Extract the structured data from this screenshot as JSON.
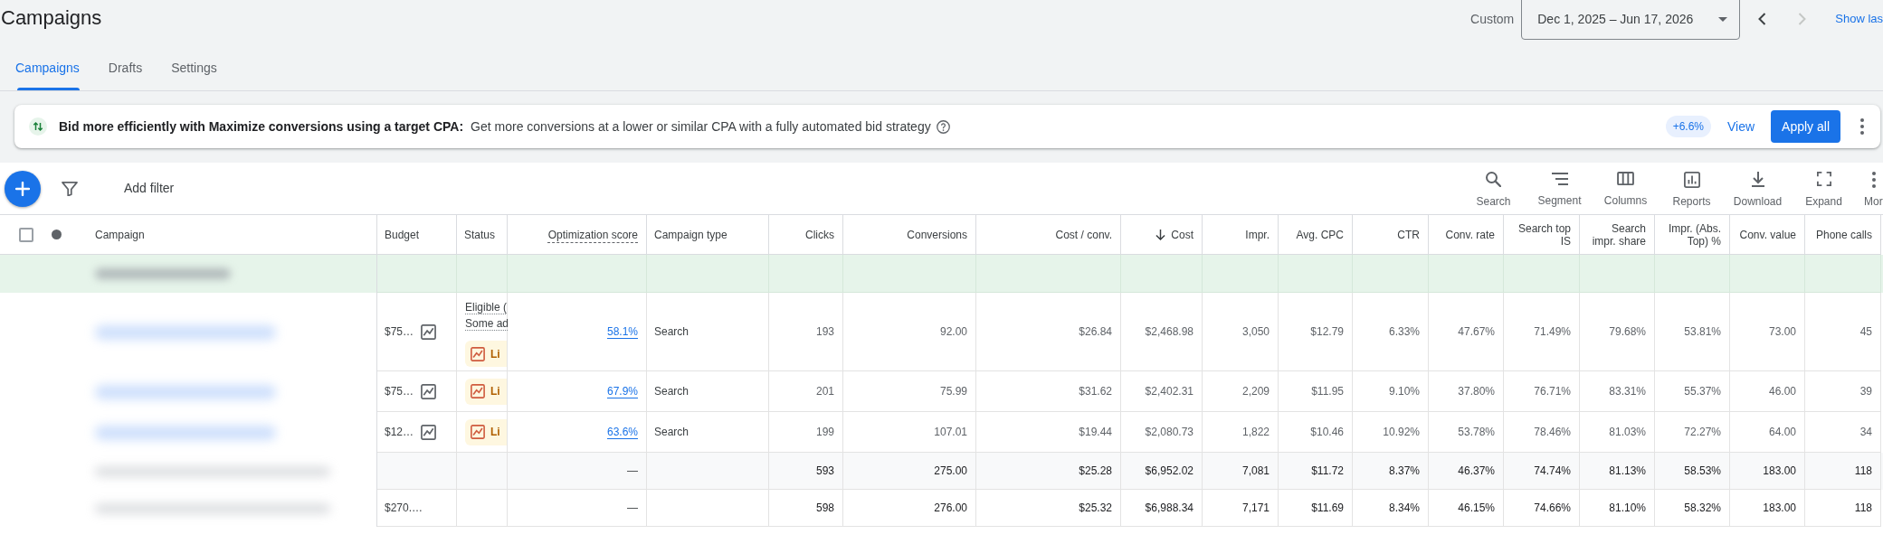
{
  "page": {
    "title": "Campaigns"
  },
  "date_range": {
    "preset": "Custom",
    "value": "Dec 1, 2025 – Jun 17, 2026",
    "prev_disabled": false,
    "next_disabled": true
  },
  "show_last": "Show las",
  "tabs": [
    {
      "label": "Campaigns",
      "selected": true
    },
    {
      "label": "Drafts",
      "selected": false
    },
    {
      "label": "Settings",
      "selected": false
    }
  ],
  "recommendation": {
    "title": "Bid more efficiently with Maximize conversions using a target CPA:",
    "description": "Get more conversions at a lower or similar CPA with a fully automated bid strategy",
    "uplift": "+6.6%",
    "view": "View",
    "apply": "Apply all"
  },
  "toolbar": {
    "add_filter": "Add filter",
    "tools": [
      {
        "kind": "search",
        "label": "Search"
      },
      {
        "kind": "segment",
        "label": "Segment"
      },
      {
        "kind": "columns",
        "label": "Columns"
      },
      {
        "kind": "reports",
        "label": "Reports"
      },
      {
        "kind": "download",
        "label": "Download"
      },
      {
        "kind": "expand",
        "label": "Expand"
      },
      {
        "kind": "more",
        "label": "Mor"
      }
    ]
  },
  "table": {
    "header_checkbox": {
      "checked": false
    },
    "columns": [
      {
        "label": "Campaign",
        "kind": "name",
        "sorted": false,
        "tooltip": false
      },
      {
        "label": "Budget",
        "kind": "text",
        "sorted": false,
        "tooltip": false
      },
      {
        "label": "Status",
        "kind": "text",
        "sorted": false,
        "tooltip": false
      },
      {
        "label": "Optimization score",
        "kind": "metric",
        "sorted": false,
        "tooltip": true
      },
      {
        "label": "Campaign type",
        "kind": "text",
        "sorted": false,
        "tooltip": false
      },
      {
        "label": "Clicks",
        "kind": "metric",
        "sorted": false,
        "tooltip": false
      },
      {
        "label": "Conversions",
        "kind": "metric",
        "sorted": false,
        "tooltip": false
      },
      {
        "label": "Cost / conv.",
        "kind": "metric",
        "sorted": false,
        "tooltip": false
      },
      {
        "label": "Cost",
        "kind": "metric",
        "sorted": true,
        "tooltip": false
      },
      {
        "label": "Impr.",
        "kind": "metric",
        "sorted": false,
        "tooltip": false
      },
      {
        "label": "Avg. CPC",
        "kind": "metric",
        "sorted": false,
        "tooltip": false
      },
      {
        "label": "CTR",
        "kind": "metric",
        "sorted": false,
        "tooltip": false
      },
      {
        "label": "Conv. rate",
        "kind": "metric",
        "sorted": false,
        "tooltip": false
      },
      {
        "label": "Search top IS",
        "kind": "metric",
        "sorted": false,
        "tooltip": false
      },
      {
        "label": "Search impr. share",
        "kind": "metric",
        "sorted": false,
        "tooltip": false
      },
      {
        "label": "Impr. (Abs. Top) %",
        "kind": "metric",
        "sorted": false,
        "tooltip": false
      },
      {
        "label": "Conv. value",
        "kind": "metric",
        "sorted": false,
        "tooltip": false
      },
      {
        "label": "Phone calls",
        "kind": "metric",
        "sorted": false,
        "tooltip": false
      }
    ],
    "rows": [
      {
        "kind": "highlight"
      },
      {
        "kind": "campaign",
        "budget": "$75…",
        "status_lines": [
          "Eligible (",
          "Some ad"
        ],
        "status_chip": "Li",
        "optimization_score": "58.1%",
        "campaign_type": "Search",
        "metrics": [
          "193",
          "92.00",
          "$26.84",
          "$2,468.98",
          "3,050",
          "$12.79",
          "6.33%",
          "47.67%",
          "71.49%",
          "79.68%",
          "53.81%",
          "73.00",
          "45"
        ]
      },
      {
        "kind": "campaign",
        "budget": "$75…",
        "status_chip": "Li",
        "optimization_score": "67.9%",
        "campaign_type": "Search",
        "metrics": [
          "201",
          "75.99",
          "$31.62",
          "$2,402.31",
          "2,209",
          "$11.95",
          "9.10%",
          "37.80%",
          "76.71%",
          "83.31%",
          "55.37%",
          "46.00",
          "39"
        ]
      },
      {
        "kind": "campaign",
        "budget": "$12…",
        "status_chip": "Li",
        "optimization_score": "63.6%",
        "campaign_type": "Search",
        "metrics": [
          "199",
          "107.01",
          "$19.44",
          "$2,080.73",
          "1,822",
          "$10.46",
          "10.92%",
          "53.78%",
          "78.46%",
          "81.03%",
          "72.27%",
          "64.00",
          "34"
        ]
      },
      {
        "kind": "subtotal",
        "optimization_score": "—",
        "metrics": [
          "593",
          "275.00",
          "$25.28",
          "$6,952.02",
          "7,081",
          "$11.72",
          "8.37%",
          "46.37%",
          "74.74%",
          "81.13%",
          "58.53%",
          "183.00",
          "118"
        ]
      },
      {
        "kind": "total",
        "budget": "$270.…",
        "optimization_score": "—",
        "metrics": [
          "598",
          "276.00",
          "$25.32",
          "$6,988.34",
          "7,171",
          "$11.69",
          "8.34%",
          "46.15%",
          "74.66%",
          "81.10%",
          "58.32%",
          "183.00",
          "118"
        ]
      }
    ]
  }
}
